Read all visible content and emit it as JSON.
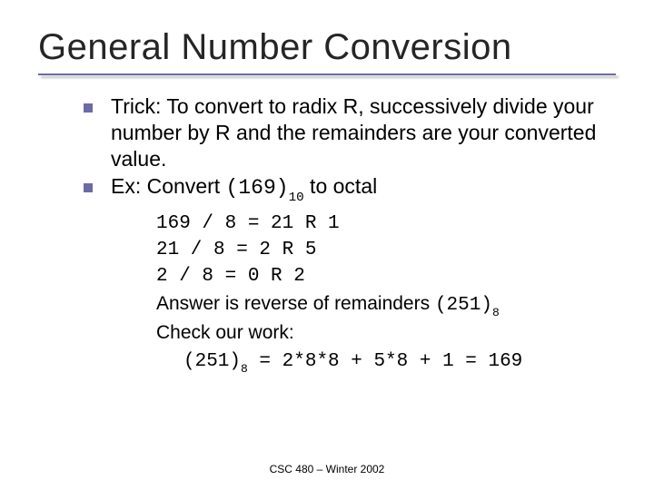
{
  "title": "General Number Conversion",
  "bullets": {
    "trick": "Trick: To convert to radix R, successively divide your number by R and the remainders are your converted value.",
    "ex_prefix": "Ex: Convert ",
    "ex_value": "(169)",
    "ex_sub": "10",
    "ex_suffix": " to octal"
  },
  "calc": {
    "l1": "169 / 8 = 21 R 1",
    "l2": "21 / 8 = 2 R 5",
    "l3": "2 / 8 = 0 R 2",
    "ans_prefix": "Answer is reverse of remainders ",
    "ans_value": "(251)",
    "ans_sub": "8",
    "check_label": "Check our work:",
    "check_value": "(251)",
    "check_sub": "8",
    "check_expr": " = 2*8*8 + 5*8 + 1 = 169"
  },
  "footer": "CSC 480 – Winter 2002"
}
